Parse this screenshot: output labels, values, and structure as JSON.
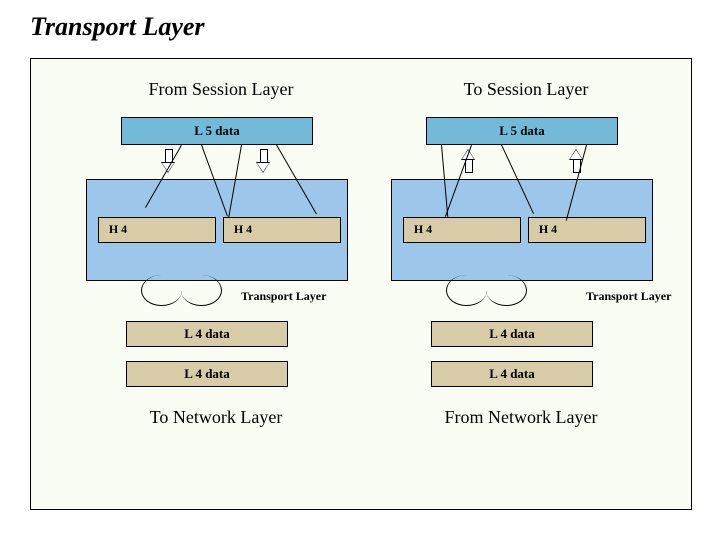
{
  "title": "Transport Layer",
  "left": {
    "heading": "From Session Layer",
    "l5": "L 5 data",
    "h4a": "H 4",
    "h4b": "H 4",
    "tl": "Transport Layer",
    "l4a": "L 4 data",
    "l4b": "L 4 data",
    "footer": "To Network Layer"
  },
  "right": {
    "heading": "To Session Layer",
    "l5": "L 5 data",
    "h4a": "H 4",
    "h4b": "H 4",
    "tl": "Transport Layer",
    "l4a": "L 4 data",
    "l4b": "L 4 data",
    "footer": "From Network Layer"
  }
}
